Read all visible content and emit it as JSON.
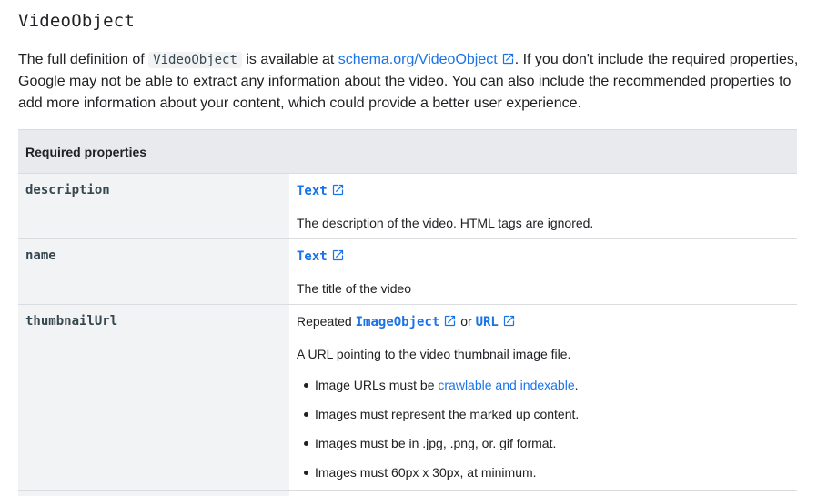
{
  "heading": "VideoObject",
  "intro": {
    "part1": "The full definition of ",
    "code": "VideoObject",
    "part2": " is available at ",
    "link_text": "schema.org/VideoObject",
    "part3": ". If you don't include the required properties, Google may not be able to extract any information about the video. You can also include the recommended properties to add more information about your content, which could provide a better user experience."
  },
  "table": {
    "header": "Required properties",
    "rows": [
      {
        "property": "description",
        "type_link": "Text",
        "description": "The description of the video. HTML tags are ignored."
      },
      {
        "property": "name",
        "type_link": "Text",
        "description": "The title of the video"
      },
      {
        "property": "thumbnailUrl",
        "type_prefix": "Repeated ",
        "type_link_1": "ImageObject",
        "type_or": " or ",
        "type_link_2": "URL",
        "description": "A URL pointing to the video thumbnail image file.",
        "bullets": {
          "b1_prefix": "Image URLs must be ",
          "b1_link": "crawlable and indexable",
          "b1_suffix": ".",
          "b2": "Images must represent the marked up content.",
          "b3": "Images must be in .jpg, .png, or. gif format.",
          "b4": "Images must 60px x 30px, at minimum."
        }
      }
    ]
  },
  "colors": {
    "link": "#1a73e8",
    "header_bg": "#e8eaed",
    "prop_bg": "#f1f3f4",
    "border": "#dadce0",
    "text": "#202124"
  },
  "icons": {
    "external_link": "open-in-new-icon"
  }
}
